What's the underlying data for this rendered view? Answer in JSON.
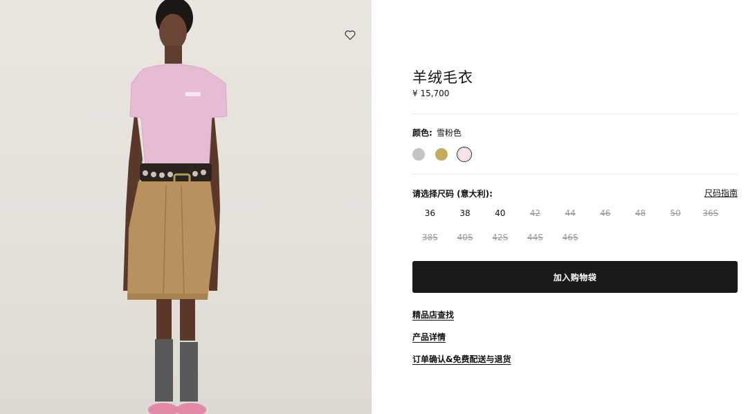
{
  "product": {
    "title": "羊绒毛衣",
    "price": "¥ 15,700"
  },
  "color": {
    "label": "颜色:",
    "selected_name": "雪粉色",
    "swatches": [
      {
        "color": "#c4c4c4"
      },
      {
        "color": "#c4aa5a"
      },
      {
        "color": "#f5e4ec"
      }
    ],
    "selected_index": 2
  },
  "sizes": {
    "heading": "请选择尺码 (意大利):",
    "guide_label": "尺码指南",
    "items": [
      {
        "label": "36",
        "available": true
      },
      {
        "label": "38",
        "available": true
      },
      {
        "label": "40",
        "available": true
      },
      {
        "label": "42",
        "available": false
      },
      {
        "label": "44",
        "available": false
      },
      {
        "label": "46",
        "available": false
      },
      {
        "label": "48",
        "available": false
      },
      {
        "label": "50",
        "available": false
      },
      {
        "label": "36S",
        "available": false
      },
      {
        "label": "38S",
        "available": false
      },
      {
        "label": "40S",
        "available": false
      },
      {
        "label": "42S",
        "available": false
      },
      {
        "label": "44S",
        "available": false
      },
      {
        "label": "46S",
        "available": false
      }
    ]
  },
  "cta": {
    "add_to_bag": "加入购物袋"
  },
  "links": {
    "store_locator": "精品店查找",
    "product_details": "产品详情",
    "order_shipping_returns": "订单确认&免费配送与退货"
  },
  "icons": {
    "wishlist": "heart-outline-icon"
  }
}
